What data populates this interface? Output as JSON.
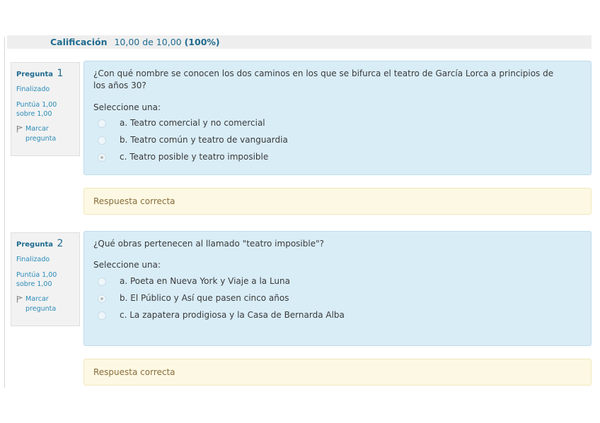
{
  "summary": {
    "grade_label": "Calificación",
    "grade_value": "10,00 de 10,00",
    "grade_percent": "(100%)"
  },
  "questions": [
    {
      "label": "Pregunta",
      "number": "1",
      "state": "Finalizado",
      "grade_line1": "Puntúa 1,00",
      "grade_line2": "sobre 1,00",
      "flag_line1": "Marcar",
      "flag_line2": "pregunta",
      "text_line1": "¿Con qué nombre se conocen los dos caminos en los que se bifurca el teatro de García Lorca a principios de",
      "text_line2": "los años 30?",
      "prompt": "Seleccione una:",
      "options": [
        {
          "text": "a. Teatro comercial y no comercial",
          "selected": false
        },
        {
          "text": "b. Teatro común y teatro de vanguardia",
          "selected": false
        },
        {
          "text": "c. Teatro posible y teatro imposible",
          "selected": true
        }
      ],
      "feedback": "Respuesta correcta"
    },
    {
      "label": "Pregunta",
      "number": "2",
      "state": "Finalizado",
      "grade_line1": "Puntúa 1,00",
      "grade_line2": "sobre 1,00",
      "flag_line1": "Marcar",
      "flag_line2": "pregunta",
      "text_line1": "¿Qué obras pertenecen al llamado \"teatro imposible\"?",
      "text_line2": "",
      "prompt": "Seleccione una:",
      "options": [
        {
          "text": "a. Poeta en Nueva York y Viaje a la Luna",
          "selected": false
        },
        {
          "text": "b. El Público y Así que pasen cinco años",
          "selected": true
        },
        {
          "text": "c. La zapatera prodigiosa y la Casa de Bernarda Alba",
          "selected": false
        }
      ],
      "feedback": "Respuesta correcta"
    }
  ]
}
